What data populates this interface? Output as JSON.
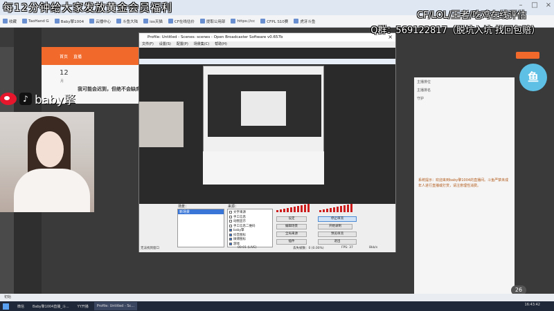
{
  "overlay": {
    "title": "每12分钟给大家发放黄金会员福利",
    "right_line1": "CF/LOL/王者/吃鸡在线评估",
    "right_line2": "Q群：569122817（脱坑入坑 找回包赔）"
  },
  "bookmarks": [
    {
      "label": "收藏"
    },
    {
      "label": "TaoHand G"
    },
    {
      "label": "Baby擎1004"
    },
    {
      "label": "云播中心"
    },
    {
      "label": "斗鱼大陆"
    },
    {
      "label": "ios天猫"
    },
    {
      "label": "CF在线估价"
    },
    {
      "label": "提取公用部"
    },
    {
      "label": "https://cc"
    },
    {
      "label": "CFPL S10赛"
    },
    {
      "label": "虎牙斗鱼"
    }
  ],
  "site": {
    "nav": [
      "首页",
      "直播"
    ],
    "level": "12",
    "level_unit": "月",
    "tagline": "我可能会迟到，但绝不会缺席"
  },
  "streamer": {
    "name": "baby擎"
  },
  "obs": {
    "title": "Profile: Untitled - Scenes: scenes - Open Broadcaster Software v0.657b",
    "menu": [
      "文件(F)",
      "设置(S)",
      "配置(P)",
      "场景集(C)",
      "帮助(H)"
    ],
    "scenes_label": "场景：",
    "sources_label": "来源：",
    "scene_selected": "新场景",
    "sources": [
      {
        "label": "文字来源",
        "on": false
      },
      {
        "label": "手工信息",
        "on": false
      },
      {
        "label": "动图显示",
        "on": false
      },
      {
        "label": "手工信息二维码",
        "on": false
      },
      {
        "label": "baby擎",
        "on": true
      },
      {
        "label": "抖音图标",
        "on": true
      },
      {
        "label": "微博图标",
        "on": true
      },
      {
        "label": "游戏",
        "on": true
      }
    ],
    "buttons": {
      "settings": "设定",
      "stop_stream": "停止串流",
      "edit_scene": "编辑场景",
      "start_record": "开始录制",
      "global_sources": "全局来源",
      "preview": "预览串流",
      "plugins": "插件",
      "exit": "退出"
    },
    "status": {
      "left": "无法找到窗口",
      "time": "00:01 (LIVE)",
      "dropped": "丢失帧数：0 (0.00%)",
      "fps": "FPS: 37",
      "kbps": "8kb/s"
    }
  },
  "right_panel": {
    "rows": [
      "主播排位",
      "主播排名",
      "守护"
    ],
    "chat": "系统提示：欢迎来到baby擎1004的直播间。斗鱼严禁未成年人进行直播或打赏，请注意理性消费。"
  },
  "badge": "26",
  "bottom_text": "初始",
  "taskbar": {
    "items": [
      "微信",
      "Baby擎1004直播_斗...",
      "YY开播",
      "Profile: Untitled - Sc..."
    ],
    "clock": "16:43:42"
  }
}
